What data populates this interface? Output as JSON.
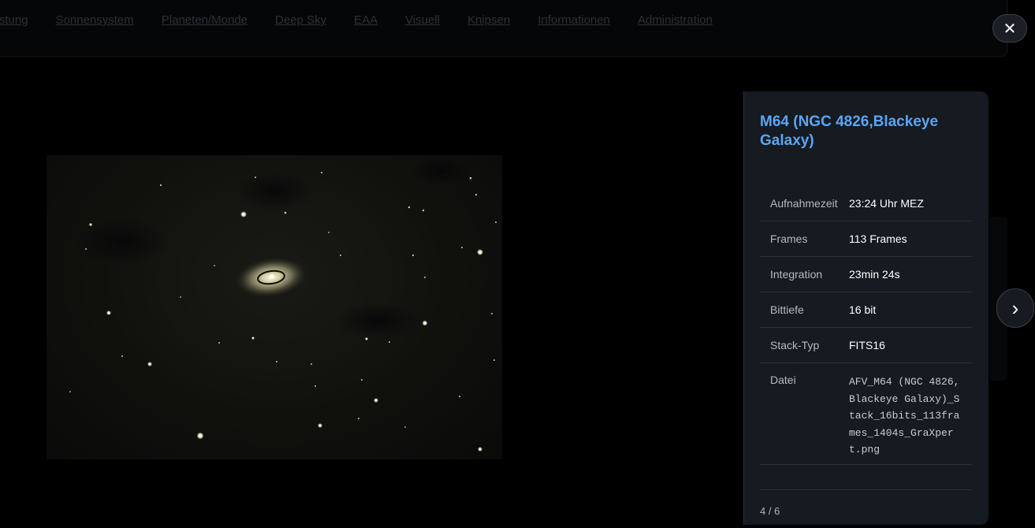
{
  "nav": [
    "srüstung",
    "Sonnensystem",
    "Planeten/Monde",
    "Deep Sky",
    "EAA",
    "Visuell",
    "Knipsen",
    "Informationen",
    "Administration"
  ],
  "close_label": "✕",
  "next_label": "›",
  "panel": {
    "title": "M64 (NGC 4826,Blackeye Galaxy)",
    "rows": [
      {
        "key": "Aufnahmezeit",
        "value": "23:24 Uhr MEZ"
      },
      {
        "key": "Frames",
        "value": "113 Frames"
      },
      {
        "key": "Integration",
        "value": "23min 24s"
      },
      {
        "key": "Bittiefe",
        "value": "16 bit"
      },
      {
        "key": "Stack-Typ",
        "value": "FITS16"
      },
      {
        "key": "Datei",
        "value": "AFV_M64 (NGC 4826,Blackeye Galaxy)_Stack_16bits_113frames_1404s_GraXpert.png"
      }
    ],
    "counter": "4 / 6"
  },
  "colors": {
    "title": "#58a6f5",
    "panel_bg": "#161a21",
    "page_bg": "#000000"
  },
  "icons": {
    "close": "close-icon",
    "next": "chevron-right-icon"
  }
}
